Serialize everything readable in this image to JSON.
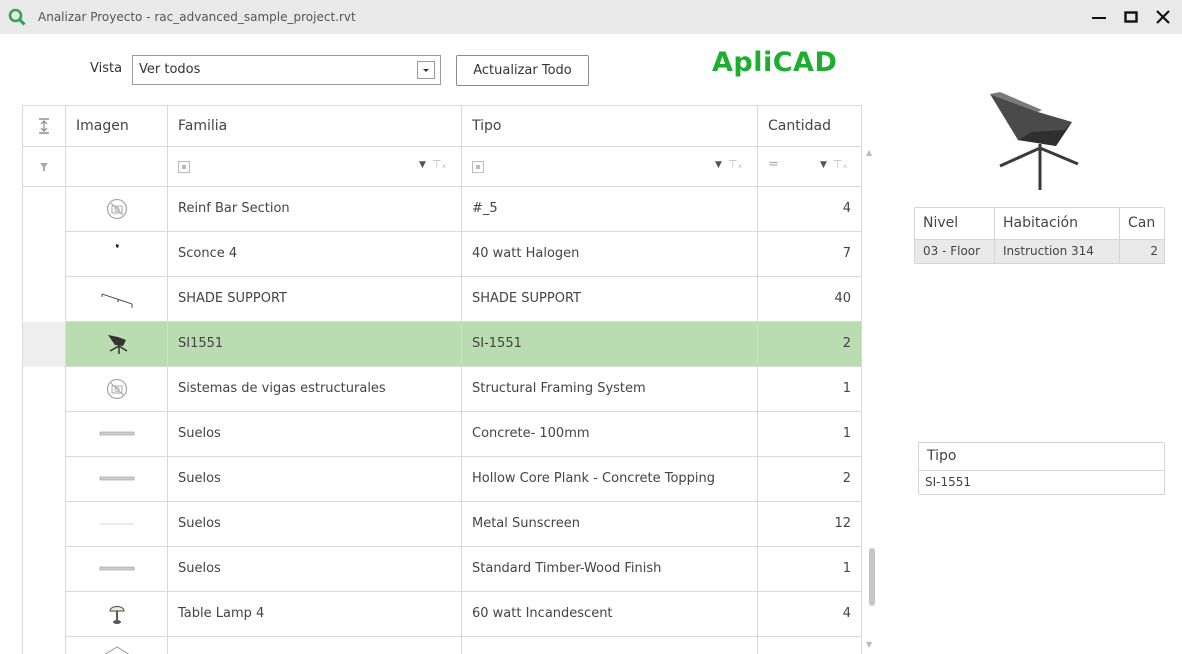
{
  "window": {
    "title": "Analizar Proyecto - rac_advanced_sample_project.rvt"
  },
  "toolbar": {
    "vista_label": "Vista",
    "vista_value": "Ver todos",
    "update_label": "Actualizar Todo",
    "brand": "ApliCAD"
  },
  "grid": {
    "headers": {
      "image": "Imagen",
      "family": "Familia",
      "type": "Tipo",
      "quantity": "Cantidad"
    },
    "filter_quantity_operator": "=",
    "rows": [
      {
        "icon": "no-image-icon",
        "family": "Reinf Bar Section",
        "type": "#_5",
        "quantity": "4"
      },
      {
        "icon": "sconce-icon",
        "family": "Sconce 4",
        "type": "40 watt Halogen",
        "quantity": "7"
      },
      {
        "icon": "shade-support-icon",
        "family": "SHADE SUPPORT",
        "type": "SHADE SUPPORT",
        "quantity": "40"
      },
      {
        "icon": "chair-icon",
        "family": "SI1551",
        "type": "SI-1551",
        "quantity": "2"
      },
      {
        "icon": "no-image-icon",
        "family": "Sistemas de vigas estructurales",
        "type": "Structural Framing System",
        "quantity": "1"
      },
      {
        "icon": "floor-slab-icon",
        "family": "Suelos",
        "type": "Concrete- 100mm",
        "quantity": "1"
      },
      {
        "icon": "floor-slab-icon",
        "family": "Suelos",
        "type": "Hollow Core Plank - Concrete Topping",
        "quantity": "2"
      },
      {
        "icon": "floor-line-icon",
        "family": "Suelos",
        "type": "Metal Sunscreen",
        "quantity": "12"
      },
      {
        "icon": "floor-slab-icon",
        "family": "Suelos",
        "type": "Standard Timber-Wood Finish",
        "quantity": "1"
      },
      {
        "icon": "table-lamp-icon",
        "family": "Table Lamp 4",
        "type": "60 watt Incandescent",
        "quantity": "4"
      }
    ]
  },
  "location_table": {
    "headers": {
      "level": "Nivel",
      "room": "Habitación",
      "count": "Can"
    },
    "rows": [
      {
        "level": "03 - Floor",
        "room": "Instruction 314",
        "count": "2"
      }
    ]
  },
  "type_table": {
    "header": "Tipo",
    "value": "SI-1551"
  },
  "colors": {
    "accent": "#1cae2f",
    "selected_row": "#b9dcb0"
  }
}
